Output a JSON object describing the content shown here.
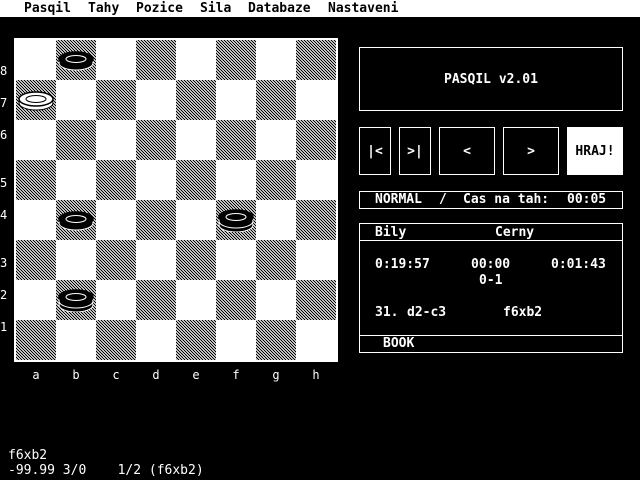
{
  "menu": [
    "Pasqil",
    "Tahy",
    "Pozice",
    "Sila",
    "Databaze",
    "Nastaveni"
  ],
  "board": {
    "ranks": [
      "8",
      "7",
      "6",
      "5",
      "4",
      "3",
      "2",
      "1"
    ],
    "files": [
      "a",
      "b",
      "c",
      "d",
      "e",
      "f",
      "g",
      "h"
    ],
    "pieces": [
      {
        "square": "b8",
        "color": "black",
        "type": "man"
      },
      {
        "square": "a7",
        "color": "white",
        "type": "man"
      },
      {
        "square": "b4",
        "color": "black",
        "type": "man"
      },
      {
        "square": "f4",
        "color": "black",
        "type": "king"
      },
      {
        "square": "b2",
        "color": "black",
        "type": "king"
      }
    ]
  },
  "title": "PASQIL v2.01",
  "nav": {
    "first": "|<",
    "last": ">|",
    "prev": "<",
    "next": ">",
    "play": "HRAJ!"
  },
  "status": {
    "mode": "NORMAL",
    "sep": "/",
    "time_label": "Cas na tah:",
    "time_value": "00:05"
  },
  "info": {
    "white_label": "Bily",
    "black_label": "Cerny",
    "white_time": "0:19:57",
    "mid_time": "00:00",
    "black_time": "0:01:43",
    "result": "0-1",
    "move_number": "31.",
    "white_move": "d2-c3",
    "black_move": "f6xb2",
    "book": "BOOK"
  },
  "bottom": {
    "line1": "f6xb2",
    "line2": "-99.99 3/0    1/2 (f6xb2)"
  }
}
